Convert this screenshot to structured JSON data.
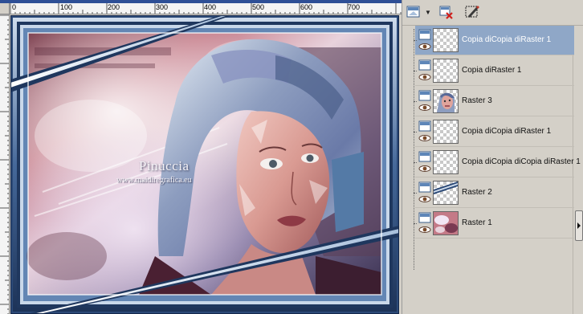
{
  "canvas": {
    "ruler_labels": [
      "0",
      "100",
      "200",
      "300",
      "400",
      "500",
      "600",
      "700"
    ],
    "watermark_title": "Pinuccia",
    "watermark_url": "www.maidiregrafica.eu"
  },
  "palette": {
    "toolbar": [
      {
        "icon": "new-layer-icon"
      },
      {
        "icon": "dropdown-arrow-icon"
      },
      {
        "icon": "delete-layer-icon"
      },
      {
        "icon": "layer-mask-icon"
      }
    ],
    "layers": [
      {
        "name": "Copia diCopia diRaster 1",
        "thumbnail": "transparent",
        "selected": true
      },
      {
        "name": "Copia diRaster 1",
        "thumbnail": "transparent",
        "selected": false
      },
      {
        "name": "Raster 3",
        "thumbnail": "portrait",
        "selected": false
      },
      {
        "name": "Copia diCopia diRaster 1",
        "thumbnail": "transparent",
        "selected": false
      },
      {
        "name": "Copia diCopia diCopia diRaster 1",
        "thumbnail": "transparent",
        "selected": false
      },
      {
        "name": "Raster 2",
        "thumbnail": "frame-strip",
        "selected": false
      },
      {
        "name": "Raster 1",
        "thumbnail": "pink-abstract",
        "selected": false
      }
    ]
  },
  "colors": {
    "selection": "#8fa7c7",
    "panel": "#d4d0c8",
    "frame": "#3f6491"
  }
}
